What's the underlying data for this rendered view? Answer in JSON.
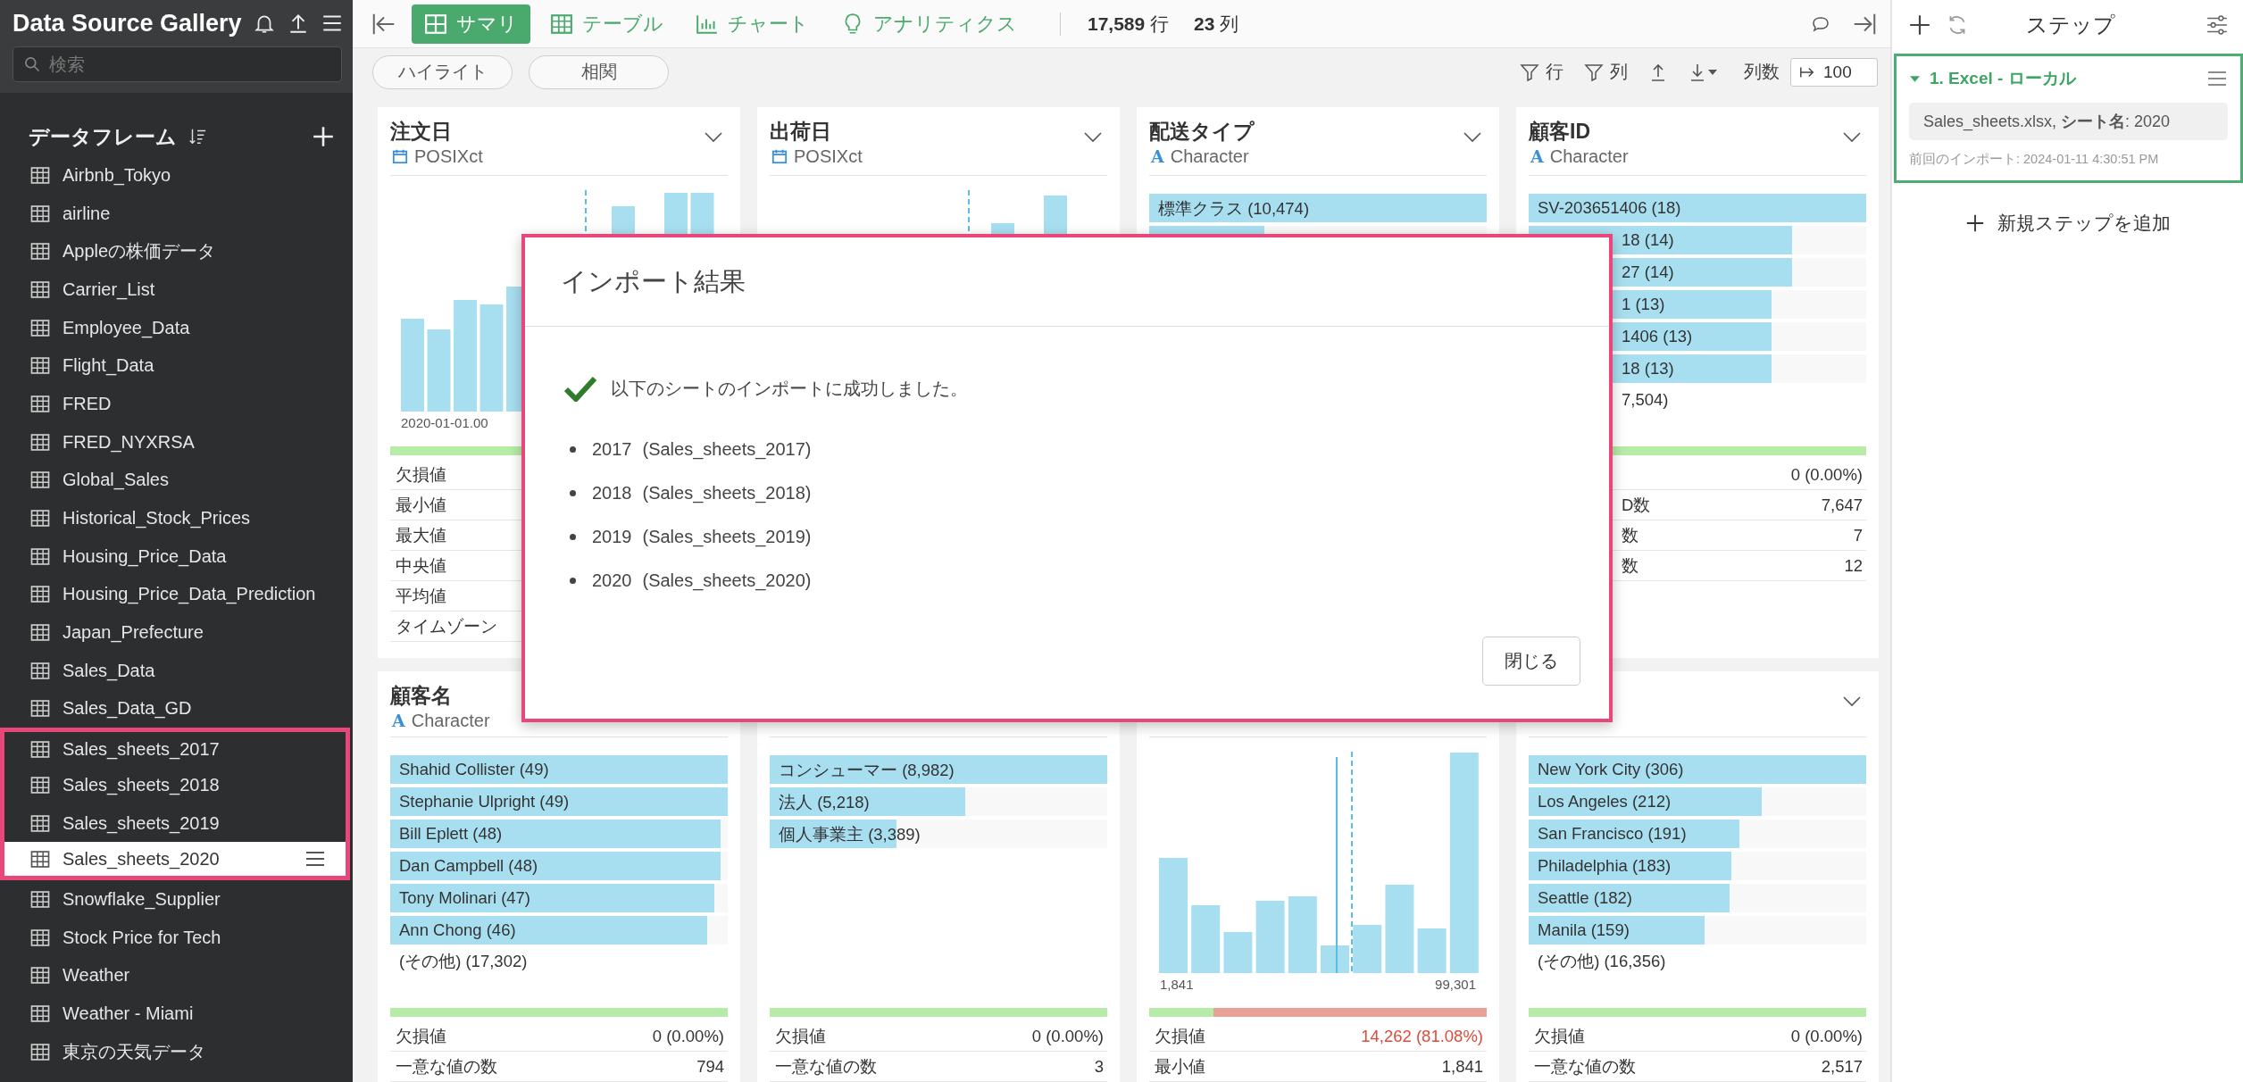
{
  "sidebar": {
    "title": "Data Source Gallery",
    "search": {
      "placeholder": "検索"
    },
    "section": "データフレーム",
    "items": [
      {
        "name": "Airbnb_Tokyo",
        "selected": false,
        "highlighted": false
      },
      {
        "name": "airline",
        "selected": false,
        "highlighted": false
      },
      {
        "name": "Appleの株価データ",
        "selected": false,
        "highlighted": false
      },
      {
        "name": "Carrier_List",
        "selected": false,
        "highlighted": false
      },
      {
        "name": "Employee_Data",
        "selected": false,
        "highlighted": false
      },
      {
        "name": "Flight_Data",
        "selected": false,
        "highlighted": false
      },
      {
        "name": "FRED",
        "selected": false,
        "highlighted": false
      },
      {
        "name": "FRED_NYXRSA",
        "selected": false,
        "highlighted": false
      },
      {
        "name": "Global_Sales",
        "selected": false,
        "highlighted": false
      },
      {
        "name": "Historical_Stock_Prices",
        "selected": false,
        "highlighted": false
      },
      {
        "name": "Housing_Price_Data",
        "selected": false,
        "highlighted": false
      },
      {
        "name": "Housing_Price_Data_Prediction",
        "selected": false,
        "highlighted": false
      },
      {
        "name": "Japan_Prefecture",
        "selected": false,
        "highlighted": false
      },
      {
        "name": "Sales_Data",
        "selected": false,
        "highlighted": false
      },
      {
        "name": "Sales_Data_GD",
        "selected": false,
        "highlighted": false
      },
      {
        "name": "Sales_sheets_2017",
        "selected": false,
        "highlighted": true
      },
      {
        "name": "Sales_sheets_2018",
        "selected": false,
        "highlighted": true
      },
      {
        "name": "Sales_sheets_2019",
        "selected": false,
        "highlighted": true
      },
      {
        "name": "Sales_sheets_2020",
        "selected": true,
        "highlighted": true
      },
      {
        "name": "Snowflake_Supplier",
        "selected": false,
        "highlighted": false
      },
      {
        "name": "Stock Price for Tech",
        "selected": false,
        "highlighted": false
      },
      {
        "name": "Weather",
        "selected": false,
        "highlighted": false
      },
      {
        "name": "Weather - Miami",
        "selected": false,
        "highlighted": false
      },
      {
        "name": "東京の天気データ",
        "selected": false,
        "highlighted": false
      }
    ]
  },
  "toolbar": {
    "views": [
      {
        "label": "サマリ",
        "selected": true
      },
      {
        "label": "テーブル",
        "selected": false
      },
      {
        "label": "チャート",
        "selected": false
      },
      {
        "label": "アナリティクス",
        "selected": false
      }
    ],
    "rows": "**17,589** 行",
    "columns": "**23** 列"
  },
  "subbar": {
    "pills": [
      "ハイライト",
      "相関"
    ],
    "actions": [
      {
        "kind": "filter",
        "label": "行"
      },
      {
        "kind": "filter",
        "label": "列"
      },
      {
        "kind": "upload"
      },
      {
        "kind": "download"
      }
    ],
    "column_count": {
      "label": "列数",
      "value": "100"
    }
  },
  "cards": [
    {
      "title": "注文日",
      "type": {
        "kind": "date",
        "label": "POSIXct"
      },
      "chevron": true,
      "kind": "histogram",
      "axis": [
        "2020-01-01.00"
      ],
      "quality": {
        "level": 1
      },
      "stats": [
        {
          "label": "欠損値"
        },
        {
          "label": "最小値"
        },
        {
          "label": "最大値"
        },
        {
          "label": "中央値"
        },
        {
          "label": "平均値"
        },
        {
          "label": "タイムゾーン"
        }
      ]
    },
    {
      "title": "出荷日",
      "type": {
        "kind": "date",
        "label": "POSIXct"
      },
      "chevron": true,
      "kind": "histogram"
    },
    {
      "title": "配送タイプ",
      "type": {
        "kind": "text",
        "glyph": "A",
        "label": "Character"
      },
      "chevron": true,
      "kind": "bars",
      "bars": [
        {
          "label": "標準クラス (10,474)",
          "level": 1
        },
        {
          "level": 0.34
        }
      ]
    },
    {
      "title": "顧客ID",
      "type": {
        "kind": "text",
        "glyph": "A",
        "label": "Character"
      },
      "chevron": true,
      "kind": "bars",
      "bars": [
        {
          "label": "SV-203651406 (18)",
          "level": 1
        },
        {
          "label": "18 (14)",
          "level": 0.78,
          "cut": true
        },
        {
          "label": "27 (14)",
          "level": 0.78,
          "cut": true
        },
        {
          "label": "1 (13)",
          "level": 0.72,
          "cut": true
        },
        {
          "label": "1406 (13)",
          "level": 0.72,
          "cut": true
        },
        {
          "label": "18 (13)",
          "level": 0.72,
          "cut": true
        }
      ],
      "other": {
        "label": "7,504)",
        "cut": true
      },
      "quality": {
        "level": 1
      },
      "stats": [
        {
          "value": "0 (0.00%)"
        },
        {
          "label": "D数",
          "value": "7,647",
          "cut": true
        },
        {
          "label": "数",
          "value": "7",
          "cut": true
        },
        {
          "label": "数",
          "value": "12",
          "cut": true
        }
      ]
    },
    {
      "title": "顧客名",
      "type": {
        "kind": "text",
        "glyph": "A",
        "label": "Character"
      },
      "chevron": false,
      "kind": "bars",
      "bars": [
        {
          "label": "Shahid Collister (49)",
          "level": 1
        },
        {
          "label": "Stephanie Ulpright (49)",
          "level": 1
        },
        {
          "label": "Bill Eplett (48)",
          "level": 0.98
        },
        {
          "label": "Dan Campbell (48)",
          "level": 0.98
        },
        {
          "label": "Tony Molinari (47)",
          "level": 0.96
        },
        {
          "label": "Ann Chong (46)",
          "level": 0.94
        }
      ],
      "other": {
        "label": "(その他) (17,302)"
      },
      "quality": {
        "level": 1
      },
      "stats": [
        {
          "label": "欠損値",
          "value": "0 (0.00%)"
        },
        {
          "label": "一意な値の数",
          "value": "794"
        }
      ]
    },
    {
      "chevron": false,
      "kind": "bars",
      "bars": [
        {
          "label": "コンシューマー (8,982)",
          "level": 1
        },
        {
          "label": "法人 (5,218)",
          "level": 0.58
        },
        {
          "label": "個人事業主 (3,389)",
          "level": 0.375
        }
      ],
      "quality": {
        "level": 1
      },
      "stats": [
        {
          "label": "欠損値",
          "value": "0 (0.00%)"
        },
        {
          "label": "一意な値の数",
          "value": "3"
        }
      ]
    },
    {
      "chevron": false,
      "kind": "histogram",
      "axis": [
        "1,841",
        "99,301"
      ],
      "quality": {
        "level": 0.19
      },
      "stats": [
        {
          "label": "欠損値",
          "value": "14,262 (81.08%)",
          "alert": true
        },
        {
          "label": "最小値",
          "value": "1,841",
          "alert": false
        }
      ]
    },
    {
      "chevron": true,
      "kind": "bars",
      "bars": [
        {
          "label": "New York City (306)",
          "level": 1
        },
        {
          "label": "Los Angeles (212)",
          "level": 0.69
        },
        {
          "label": "San Francisco (191)",
          "level": 0.625
        },
        {
          "label": "Philadelphia (183)",
          "level": 0.6
        },
        {
          "label": "Seattle (182)",
          "level": 0.595
        },
        {
          "label": "Manila (159)",
          "level": 0.52
        }
      ],
      "other": {
        "label": "(その他) (16,356)"
      },
      "quality": {
        "level": 1
      },
      "stats": [
        {
          "label": "欠損値",
          "value": "0 (0.00%)"
        },
        {
          "label": "一意な値の数",
          "value": "2,517"
        }
      ]
    }
  ],
  "dialog": {
    "title": "インポート結果",
    "message": "以下のシートのインポートに成功しました。",
    "sheets": [
      {
        "sheet": "2017",
        "frame": "(Sales_sheets_2017)"
      },
      {
        "sheet": "2018",
        "frame": "(Sales_sheets_2018)"
      },
      {
        "sheet": "2019",
        "frame": "(Sales_sheets_2019)"
      },
      {
        "sheet": "2020",
        "frame": "(Sales_sheets_2020)"
      }
    ],
    "close": "閉じる"
  },
  "steps_panel": {
    "title": "ステップ",
    "steps": [
      {
        "title": "1. Excel - ローカル",
        "expanded": true,
        "selected": true,
        "detail": "Sales_sheets.xlsx, **シート名**: 2020",
        "last_import": "前回のインポート: 2024-01-11 4:30:51 PM"
      }
    ],
    "add_label": "新規ステップを追加"
  }
}
